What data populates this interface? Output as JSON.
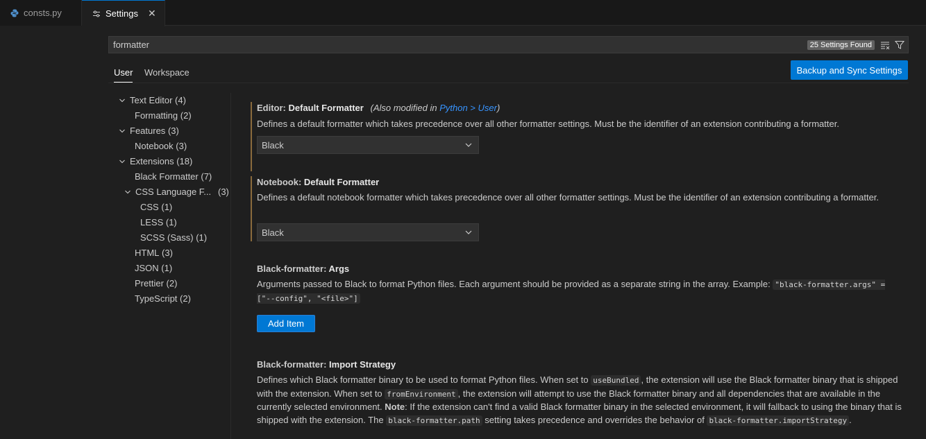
{
  "tabs": [
    {
      "label": "consts.py",
      "icon": "python-icon",
      "active": false
    },
    {
      "label": "Settings",
      "icon": "settings-sliders-icon",
      "active": true,
      "close": "✕"
    }
  ],
  "search": {
    "query": "formatter",
    "count_badge": "25 Settings Found",
    "icons": [
      "clear-filter-icon",
      "filter-icon"
    ]
  },
  "scope_tabs": {
    "user": "User",
    "workspace": "Workspace"
  },
  "backup_button": "Backup and Sync Settings",
  "toc": [
    {
      "label": "Text Editor",
      "count": "(4)",
      "expanded": true
    },
    {
      "label": "Formatting",
      "count": "(2)"
    },
    {
      "label": "Features",
      "count": "(3)",
      "expanded": true
    },
    {
      "label": "Notebook",
      "count": "(3)"
    },
    {
      "label": "Extensions",
      "count": "(18)",
      "expanded": true
    },
    {
      "label": "Black Formatter",
      "count": "(7)"
    },
    {
      "label": "CSS Language F...",
      "count": "(3)",
      "expanded": true
    },
    {
      "label": "CSS",
      "count": "(1)"
    },
    {
      "label": "LESS",
      "count": "(1)"
    },
    {
      "label": "SCSS (Sass)",
      "count": "(1)"
    },
    {
      "label": "HTML",
      "count": "(3)"
    },
    {
      "label": "JSON",
      "count": "(1)"
    },
    {
      "label": "Prettier",
      "count": "(2)"
    },
    {
      "label": "TypeScript",
      "count": "(2)"
    }
  ],
  "settings": {
    "editor_default_formatter": {
      "category": "Editor: ",
      "name": "Default Formatter",
      "modified_prefix": "(Also modified in ",
      "modified_link": "Python > User",
      "modified_suffix": ")",
      "description": "Defines a default formatter which takes precedence over all other formatter settings. Must be the identifier of an extension contributing a formatter.",
      "value": "Black"
    },
    "notebook_default_formatter": {
      "category": "Notebook: ",
      "name": "Default Formatter",
      "description": "Defines a default notebook formatter which takes precedence over all other formatter settings. Must be the identifier of an extension contributing a formatter.",
      "value": "Black"
    },
    "black_args": {
      "category": "Black-formatter: ",
      "name": "Args",
      "description_text": "Arguments passed to Black to format Python files. Each argument should be provided as a separate string in the array. Example: ",
      "description_code": "\"black-formatter.args\" = [\"--config\", \"<file>\"]",
      "button": "Add Item"
    },
    "black_import_strategy": {
      "category": "Black-formatter: ",
      "name": "Import Strategy",
      "d1": "Defines which Black formatter binary to be used to format Python files. When set to ",
      "c1": "useBundled",
      "d2": ", the extension will use the Black formatter binary that is shipped with the extension. When set to ",
      "c2": "fromEnvironment",
      "d3": ", the extension will attempt to use the Black formatter binary and all dependencies that are available in the currently selected environment. ",
      "note_label": "Note",
      "d4": ": If the extension can't find a valid Black formatter binary in the selected environment, it will fallback to using the binary that is shipped with the extension. The ",
      "c3": "black-formatter.path",
      "d5": " setting takes precedence and overrides the behavior of ",
      "c4": "black-formatter.importStrategy",
      "d6": "."
    }
  }
}
